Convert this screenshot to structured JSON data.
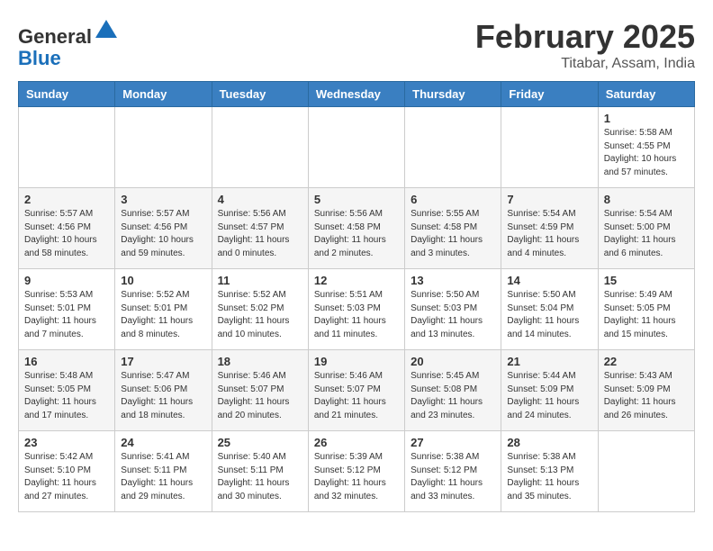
{
  "header": {
    "logo": {
      "general": "General",
      "blue": "Blue"
    },
    "title": "February 2025",
    "subtitle": "Titabar, Assam, India"
  },
  "days_of_week": [
    "Sunday",
    "Monday",
    "Tuesday",
    "Wednesday",
    "Thursday",
    "Friday",
    "Saturday"
  ],
  "weeks": [
    [
      {
        "day": "",
        "info": ""
      },
      {
        "day": "",
        "info": ""
      },
      {
        "day": "",
        "info": ""
      },
      {
        "day": "",
        "info": ""
      },
      {
        "day": "",
        "info": ""
      },
      {
        "day": "",
        "info": ""
      },
      {
        "day": "1",
        "info": "Sunrise: 5:58 AM\nSunset: 4:55 PM\nDaylight: 10 hours and 57 minutes."
      }
    ],
    [
      {
        "day": "2",
        "info": "Sunrise: 5:57 AM\nSunset: 4:56 PM\nDaylight: 10 hours and 58 minutes."
      },
      {
        "day": "3",
        "info": "Sunrise: 5:57 AM\nSunset: 4:56 PM\nDaylight: 10 hours and 59 minutes."
      },
      {
        "day": "4",
        "info": "Sunrise: 5:56 AM\nSunset: 4:57 PM\nDaylight: 11 hours and 0 minutes."
      },
      {
        "day": "5",
        "info": "Sunrise: 5:56 AM\nSunset: 4:58 PM\nDaylight: 11 hours and 2 minutes."
      },
      {
        "day": "6",
        "info": "Sunrise: 5:55 AM\nSunset: 4:58 PM\nDaylight: 11 hours and 3 minutes."
      },
      {
        "day": "7",
        "info": "Sunrise: 5:54 AM\nSunset: 4:59 PM\nDaylight: 11 hours and 4 minutes."
      },
      {
        "day": "8",
        "info": "Sunrise: 5:54 AM\nSunset: 5:00 PM\nDaylight: 11 hours and 6 minutes."
      }
    ],
    [
      {
        "day": "9",
        "info": "Sunrise: 5:53 AM\nSunset: 5:01 PM\nDaylight: 11 hours and 7 minutes."
      },
      {
        "day": "10",
        "info": "Sunrise: 5:52 AM\nSunset: 5:01 PM\nDaylight: 11 hours and 8 minutes."
      },
      {
        "day": "11",
        "info": "Sunrise: 5:52 AM\nSunset: 5:02 PM\nDaylight: 11 hours and 10 minutes."
      },
      {
        "day": "12",
        "info": "Sunrise: 5:51 AM\nSunset: 5:03 PM\nDaylight: 11 hours and 11 minutes."
      },
      {
        "day": "13",
        "info": "Sunrise: 5:50 AM\nSunset: 5:03 PM\nDaylight: 11 hours and 13 minutes."
      },
      {
        "day": "14",
        "info": "Sunrise: 5:50 AM\nSunset: 5:04 PM\nDaylight: 11 hours and 14 minutes."
      },
      {
        "day": "15",
        "info": "Sunrise: 5:49 AM\nSunset: 5:05 PM\nDaylight: 11 hours and 15 minutes."
      }
    ],
    [
      {
        "day": "16",
        "info": "Sunrise: 5:48 AM\nSunset: 5:05 PM\nDaylight: 11 hours and 17 minutes."
      },
      {
        "day": "17",
        "info": "Sunrise: 5:47 AM\nSunset: 5:06 PM\nDaylight: 11 hours and 18 minutes."
      },
      {
        "day": "18",
        "info": "Sunrise: 5:46 AM\nSunset: 5:07 PM\nDaylight: 11 hours and 20 minutes."
      },
      {
        "day": "19",
        "info": "Sunrise: 5:46 AM\nSunset: 5:07 PM\nDaylight: 11 hours and 21 minutes."
      },
      {
        "day": "20",
        "info": "Sunrise: 5:45 AM\nSunset: 5:08 PM\nDaylight: 11 hours and 23 minutes."
      },
      {
        "day": "21",
        "info": "Sunrise: 5:44 AM\nSunset: 5:09 PM\nDaylight: 11 hours and 24 minutes."
      },
      {
        "day": "22",
        "info": "Sunrise: 5:43 AM\nSunset: 5:09 PM\nDaylight: 11 hours and 26 minutes."
      }
    ],
    [
      {
        "day": "23",
        "info": "Sunrise: 5:42 AM\nSunset: 5:10 PM\nDaylight: 11 hours and 27 minutes."
      },
      {
        "day": "24",
        "info": "Sunrise: 5:41 AM\nSunset: 5:11 PM\nDaylight: 11 hours and 29 minutes."
      },
      {
        "day": "25",
        "info": "Sunrise: 5:40 AM\nSunset: 5:11 PM\nDaylight: 11 hours and 30 minutes."
      },
      {
        "day": "26",
        "info": "Sunrise: 5:39 AM\nSunset: 5:12 PM\nDaylight: 11 hours and 32 minutes."
      },
      {
        "day": "27",
        "info": "Sunrise: 5:38 AM\nSunset: 5:12 PM\nDaylight: 11 hours and 33 minutes."
      },
      {
        "day": "28",
        "info": "Sunrise: 5:38 AM\nSunset: 5:13 PM\nDaylight: 11 hours and 35 minutes."
      },
      {
        "day": "",
        "info": ""
      }
    ]
  ]
}
